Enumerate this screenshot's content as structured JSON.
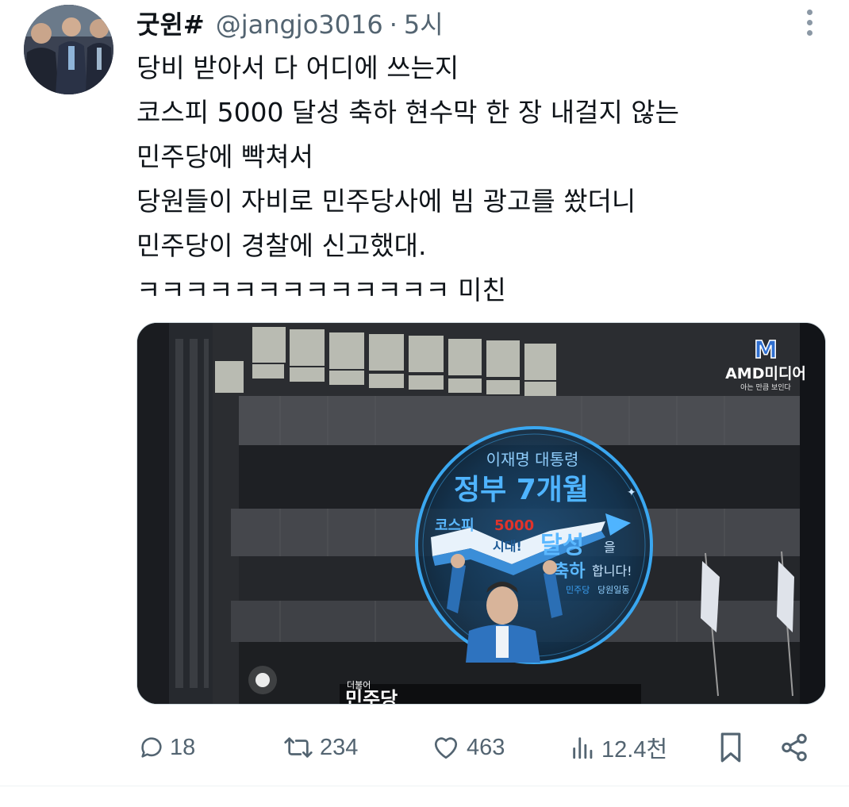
{
  "author": {
    "display_name": "굿윈#",
    "handle": "@jangjo3016",
    "separator": "·",
    "time": "5시"
  },
  "tweet": {
    "lines": [
      "당비 받아서 다 어디에 쓰는지",
      "코스피 5000 달성 축하 현수막 한 장 내걸지 않는",
      "민주당에 빡쳐서",
      "당원들이 자비로 민주당사에 빔 광고를 쐈더니",
      "민주당이 경찰에 신고했대.",
      "ㅋㅋㅋㅋㅋㅋㅋㅋㅋㅋㅋㅋㅋ 미친"
    ]
  },
  "media": {
    "watermark_logo": "M",
    "watermark_brand": "AMD미디어",
    "watermark_tagline": "아는 만큼 보인다",
    "projection_line1": "이재명 대통령",
    "projection_line2": "정부 7개월",
    "banner_line1a": "코스피",
    "banner_line1b": "5000",
    "banner_line2": "시대!",
    "achieve_word": "달성",
    "achieve_particle": "을",
    "celebrate_word": "축하",
    "celebrate_rest": "합니다!",
    "signature_party": "민주당",
    "signature_group": "당원일동",
    "building_sign_small": "더불어",
    "building_sign": "민주당"
  },
  "actions": {
    "reply_count": "18",
    "retweet_count": "234",
    "like_count": "463",
    "view_count": "12.4천"
  },
  "icons": {
    "reply": "reply-icon",
    "retweet": "retweet-icon",
    "like": "heart-icon",
    "views": "views-icon",
    "bookmark": "bookmark-icon",
    "share": "share-icon",
    "more": "more-icon"
  },
  "colors": {
    "text": "#0f1419",
    "secondary": "#536471",
    "projection_blue": "#3aa7f0"
  }
}
